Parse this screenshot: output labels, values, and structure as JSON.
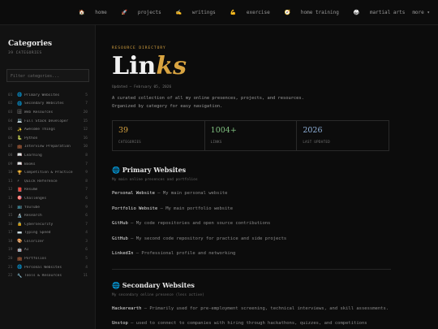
{
  "nav": [
    {
      "icon": "🏠",
      "label": "home"
    },
    {
      "icon": "🚀",
      "label": "projects"
    },
    {
      "icon": "✍️",
      "label": "writings"
    },
    {
      "icon": "💪",
      "label": "exercise"
    },
    {
      "icon": "🧭",
      "label": "home training"
    },
    {
      "icon": "🥋",
      "label": "martial arts"
    },
    {
      "icon": "",
      "label": "more ▾"
    }
  ],
  "sidebar": {
    "title": "Categories",
    "subtitle": "39 CATEGORIES",
    "filter_placeholder": "Filter categories...",
    "categories": [
      {
        "num": "01",
        "icon": "🌐",
        "name": "Primary Websites",
        "count": "5"
      },
      {
        "num": "02",
        "icon": "🌐",
        "name": "Secondary Websites",
        "count": "7"
      },
      {
        "num": "03",
        "icon": "🗄",
        "name": "Web Resources",
        "count": "20"
      },
      {
        "num": "04",
        "icon": "💻",
        "name": "Full Stack Developer",
        "count": "15"
      },
      {
        "num": "05",
        "icon": "✨",
        "name": "Awesome Things",
        "count": "12"
      },
      {
        "num": "06",
        "icon": "🐍",
        "name": "Python",
        "count": "16"
      },
      {
        "num": "07",
        "icon": "💼",
        "name": "Interview Preparation",
        "count": "10"
      },
      {
        "num": "08",
        "icon": "📖",
        "name": "Learning",
        "count": "8"
      },
      {
        "num": "09",
        "icon": "📖",
        "name": "Books",
        "count": "7"
      },
      {
        "num": "10",
        "icon": "🏆",
        "name": "Competition & Practice",
        "count": "9"
      },
      {
        "num": "11",
        "icon": "⚡",
        "name": "Quick Reference",
        "count": "8"
      },
      {
        "num": "12",
        "icon": "📕",
        "name": "Resume",
        "count": "7"
      },
      {
        "num": "13",
        "icon": "🎯",
        "name": "Challenges",
        "count": "6"
      },
      {
        "num": "14",
        "icon": "📺",
        "name": "YouTube",
        "count": "9"
      },
      {
        "num": "15",
        "icon": "🔬",
        "name": "Research",
        "count": "6"
      },
      {
        "num": "16",
        "icon": "🔒",
        "name": "Cybersecurity",
        "count": "7"
      },
      {
        "num": "17",
        "icon": "⌨️",
        "name": "Typing Speed",
        "count": "4"
      },
      {
        "num": "18",
        "icon": "🎨",
        "name": "Colorizer",
        "count": "3"
      },
      {
        "num": "19",
        "icon": "🤖",
        "name": "AI",
        "count": "6"
      },
      {
        "num": "20",
        "icon": "💼",
        "name": "Portfolios",
        "count": "5"
      },
      {
        "num": "21",
        "icon": "🌐",
        "name": "Personal Websites",
        "count": "4"
      },
      {
        "num": "22",
        "icon": "🔧",
        "name": "Tools & Resources",
        "count": "11"
      }
    ]
  },
  "main": {
    "eyebrow": "RESOURCE DIRECTORY",
    "title_plain": "Lin",
    "title_accent": "ks",
    "updated": "Updated — February 05, 2026",
    "description": "A curated collection of all my online presences, projects, and resources. Organized by category for easy navigation.",
    "stats": [
      {
        "value": "39",
        "label": "CATEGORIES",
        "color": "#d9a441"
      },
      {
        "value": "1004+",
        "label": "LINKS",
        "color": "#7fbf7f"
      },
      {
        "value": "2026",
        "label": "LAST UPDATED",
        "color": "#8fb0d8"
      }
    ],
    "sections": [
      {
        "title": "🌐 Primary Websites",
        "subtitle": "My main online presences and portfolios",
        "links": [
          {
            "name": "Personal Website",
            "desc": " — My main personal website"
          },
          {
            "name": "Portfolio Website",
            "desc": " — My main portfolio website"
          },
          {
            "name": "GitHub",
            "desc": " — My code repositories and open source contributions"
          },
          {
            "name": "GitHub",
            "desc": " — My second code repository for practice and side projects"
          },
          {
            "name": "LinkedIn",
            "desc": " — Professional profile and networking"
          }
        ]
      },
      {
        "title": "🌐 Secondary Websites",
        "subtitle": "My secondary online presence (less active)",
        "links": [
          {
            "name": "Hackerearth",
            "desc": " — Primarily used for pre-employment screening, technical interviews, and skill assessments."
          },
          {
            "name": "Unstop",
            "desc": " — used to connect to companies with hiring through hackathons, quizzes, and competitions"
          }
        ]
      }
    ]
  }
}
